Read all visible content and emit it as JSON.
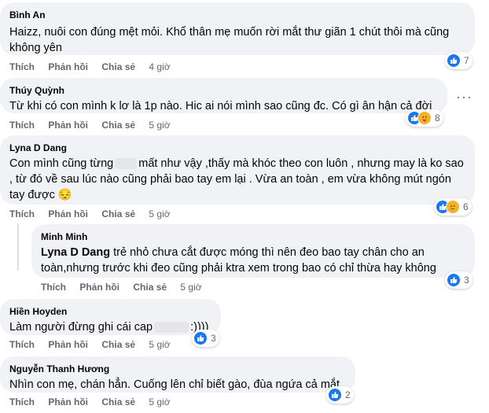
{
  "actions": {
    "like": "Thích",
    "reply": "Phản hồi",
    "share": "Chia sẻ"
  },
  "comments": [
    {
      "author": "Bình An",
      "text": "Haizz, nuôi con đúng mệt mỏi. Khổ thân mẹ muốn rời mắt thư giãn 1 chút thôi mà cũng không yên",
      "time": "4 giờ",
      "reactions": [
        "like-icon"
      ],
      "count": "7"
    },
    {
      "author": "Thúy Quỳnh",
      "text": "Từ khi có con mình k lơ là 1p nào. Hic ai nói mình sao cũng đc. Có gì ân hận cả đời",
      "time": "5 giờ",
      "reactions": [
        "like-icon",
        "care-icon"
      ],
      "count": "8"
    },
    {
      "author": "Lyna D Dang",
      "text_a": "Con mình cũng từng",
      "text_b": "mất như vậy ,thấy mà khóc theo con luôn , nhưng may là ko sao , từ đó về sau lúc nào cũng phải bao tay em lại . Vừa an toàn , em vừa không mút ngón tay được 😔",
      "time": "5 giờ",
      "reactions": [
        "like-icon",
        "sad-icon"
      ],
      "count": "6"
    },
    {
      "author": "Minh Minh",
      "mention": "Lyna D Dang",
      "text": "trẻ nhỏ chưa cắt được móng thì nên đeo bao tay chân cho an toàn,nhưng trước khi đeo cũng phải ktra xem trong bao có chỉ thừa hay không",
      "time": "5 giờ",
      "reactions": [
        "like-icon"
      ],
      "count": "3"
    },
    {
      "author": "Hiền Hoyden",
      "text_a": "Làm người đừng ghi cái cap",
      "text_b": ":))))",
      "time": "5 giờ",
      "reactions": [
        "like-icon"
      ],
      "count": "3"
    },
    {
      "author": "Nguyễn Thanh Hương",
      "text": "Nhìn con mẹ, chán hẳn. Cuống lên chỉ biết gào, đùa ngứa cả mắt",
      "time": "5 giờ",
      "reactions": [
        "like-icon"
      ],
      "count": "2"
    }
  ],
  "colors": {
    "bubble": "#f0f2f5",
    "meta": "#65676b",
    "like": "#1877f2",
    "emoji": "#f7b125"
  }
}
